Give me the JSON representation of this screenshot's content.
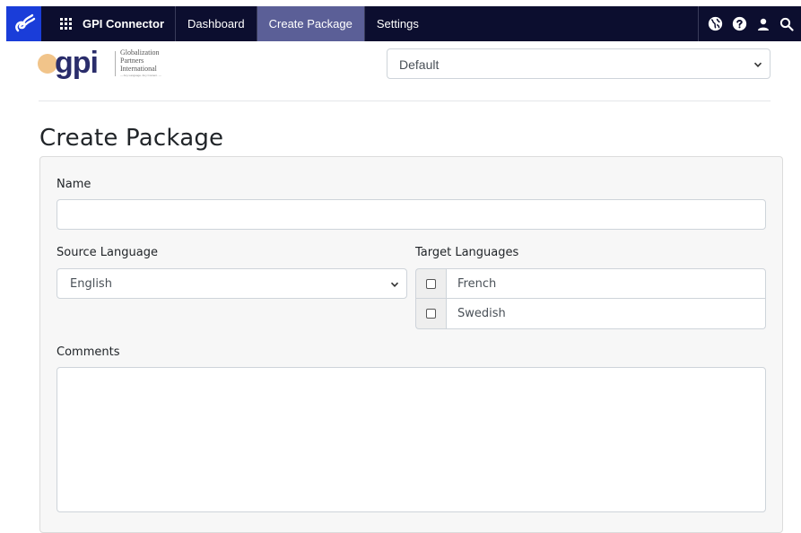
{
  "nav": {
    "brand": "GPI Connector",
    "links": [
      {
        "label": "Dashboard",
        "active": false
      },
      {
        "label": "Create Package",
        "active": true
      },
      {
        "label": "Settings",
        "active": false
      }
    ],
    "icons": [
      "globe-icon",
      "help-icon",
      "user-icon",
      "search-icon"
    ]
  },
  "header": {
    "logo": {
      "wordmark": "gpi",
      "line1": "Globalization",
      "line2": "Partners",
      "line3": "International",
      "tagline": "— Any Language. Any Content. —"
    },
    "project_select": "Default"
  },
  "page": {
    "title": "Create Package"
  },
  "form": {
    "name_label": "Name",
    "name_value": "",
    "source_label": "Source Language",
    "source_value": "English",
    "target_label": "Target Languages",
    "targets": [
      {
        "name": "French",
        "checked": false
      },
      {
        "name": "Swedish",
        "checked": false
      }
    ],
    "comments_label": "Comments",
    "comments_value": ""
  },
  "colors": {
    "nav_bg": "#0c0e2f",
    "nav_active": "#5b5f97",
    "logo_blue": "#1a3dd9",
    "brand_navy": "#2a2d6b",
    "brand_peach": "#f1c48a"
  }
}
